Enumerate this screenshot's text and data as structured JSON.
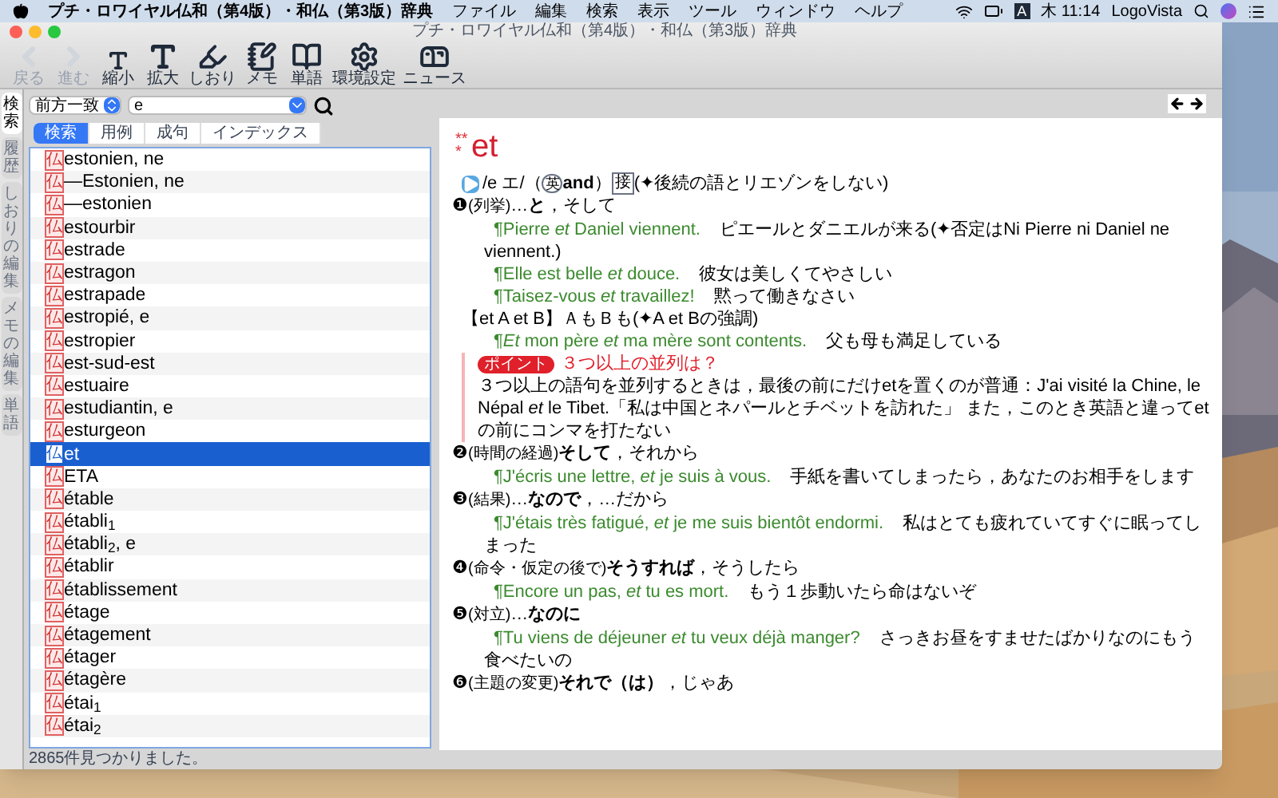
{
  "menu_bar": {
    "app_name": "プチ・ロワイヤル仏和（第4版）・和仏（第3版）辞典",
    "menus": [
      "ファイル",
      "編集",
      "検索",
      "表示",
      "ツール",
      "ウィンドウ",
      "ヘルプ"
    ],
    "input_source": "A",
    "clock": "木 11:14",
    "user": "LogoVista"
  },
  "window": {
    "title": "プチ・ロワイヤル仏和（第4版）・和仏（第3版）辞典"
  },
  "toolbar": [
    {
      "kind": "back",
      "label": "戻る",
      "disabled": true
    },
    {
      "kind": "forward",
      "label": "進む",
      "disabled": true
    },
    {
      "kind": "shrink",
      "label": "縮小",
      "disabled": false
    },
    {
      "kind": "enlarge",
      "label": "拡大",
      "disabled": false
    },
    {
      "kind": "bookmark",
      "label": "しおり",
      "disabled": false
    },
    {
      "kind": "memo",
      "label": "メモ",
      "disabled": false
    },
    {
      "kind": "words",
      "label": "単語",
      "disabled": false
    },
    {
      "kind": "settings",
      "label": "環境設定",
      "disabled": false
    },
    {
      "kind": "news",
      "label": "ニュース",
      "disabled": false
    }
  ],
  "side_tabs": [
    {
      "label": "検索",
      "selected": true
    },
    {
      "label": "履歴",
      "selected": false
    },
    {
      "label": "しおりの編集",
      "selected": false
    },
    {
      "label": "メモの編集",
      "selected": false
    },
    {
      "label": "単語",
      "selected": false
    }
  ],
  "search": {
    "mode": "前方一致",
    "query": "e"
  },
  "search_tabs": [
    {
      "label": "検索",
      "selected": true
    },
    {
      "label": "用例",
      "selected": false
    },
    {
      "label": "成句",
      "selected": false
    },
    {
      "label": "インデックス",
      "selected": false
    }
  ],
  "results": [
    {
      "dict": "仏",
      "word": "estonien, ne",
      "selected": false
    },
    {
      "dict": "仏",
      "word": "—Estonien, ne",
      "selected": false
    },
    {
      "dict": "仏",
      "word": "—estonien",
      "selected": false
    },
    {
      "dict": "仏",
      "word": "estourbir",
      "selected": false
    },
    {
      "dict": "仏",
      "word": "estrade",
      "selected": false
    },
    {
      "dict": "仏",
      "word": "estragon",
      "selected": false
    },
    {
      "dict": "仏",
      "word": "estrapade",
      "selected": false
    },
    {
      "dict": "仏",
      "word": "estropié, e",
      "selected": false
    },
    {
      "dict": "仏",
      "word": "estropier",
      "selected": false
    },
    {
      "dict": "仏",
      "word": "est-sud-est",
      "selected": false
    },
    {
      "dict": "仏",
      "word": "estuaire",
      "selected": false
    },
    {
      "dict": "仏",
      "word": "estudiantin, e",
      "selected": false
    },
    {
      "dict": "仏",
      "word": "esturgeon",
      "selected": false
    },
    {
      "dict": "仏",
      "word": "et",
      "selected": true
    },
    {
      "dict": "仏",
      "word": "ETA",
      "selected": false
    },
    {
      "dict": "仏",
      "word": "étable",
      "selected": false
    },
    {
      "dict": "仏",
      "word": "établi$_{1}$",
      "selected": false
    },
    {
      "dict": "仏",
      "word": "établi$_{2}$, e",
      "selected": false
    },
    {
      "dict": "仏",
      "word": "établir",
      "selected": false
    },
    {
      "dict": "仏",
      "word": "établissement",
      "selected": false
    },
    {
      "dict": "仏",
      "word": "étage",
      "selected": false
    },
    {
      "dict": "仏",
      "word": "étagement",
      "selected": false
    },
    {
      "dict": "仏",
      "word": "étager",
      "selected": false
    },
    {
      "dict": "仏",
      "word": "étagère",
      "selected": false
    },
    {
      "dict": "仏",
      "word": "étai$_{1}$",
      "selected": false
    },
    {
      "dict": "仏",
      "word": "étai$_{2}$",
      "selected": false
    }
  ],
  "status": "2865件見つかりました。",
  "entry": {
    "stars": "***",
    "headword": "et",
    "pron": {
      "before": "/e エ/（",
      "lang": "英",
      "word": "and",
      "after": "）",
      "pos": "接",
      "note": "(✦後続の語とリエゾンをしない)"
    },
    "blocks": [
      {
        "kind": "sense",
        "num": "❶",
        "label": "(列挙)",
        "text": "…**と**，そして"
      },
      {
        "kind": "example",
        "fr": "¶Pierre *et* Daniel viennent.",
        "ja": "ピエールとダニエルが来る(✦否定はNi Pierre ni Daniel ne viennent.)"
      },
      {
        "kind": "example",
        "fr": "¶Elle est belle *et* douce.",
        "ja": "彼女は美しくてやさしい"
      },
      {
        "kind": "example",
        "fr": "¶Taisez-vous *et* travaillez!",
        "ja": "黙って働きなさい"
      },
      {
        "kind": "phrase",
        "text": "【et A et B】ＡもＢも(✦A et Bの強調)"
      },
      {
        "kind": "example",
        "fr": "¶*Et* mon père *et* ma mère sont contents.",
        "ja": "父も母も満足している"
      },
      {
        "kind": "point",
        "badge": "ポイント",
        "title": "３つ以上の並列は？",
        "text": "３つ以上の語句を並列するときは，最後の前にだけetを置くのが普通：J'ai visité la Chine, le Népal *et* le Tibet.「私は中国とネパールとチベットを訪れた」 また，このとき英語と違ってetの前にコンマを打たない"
      },
      {
        "kind": "sense",
        "num": "❷",
        "label": "(時間の経過)",
        "text": "**そして**，それから"
      },
      {
        "kind": "example",
        "fr": "¶J'écris une lettre, *et* je suis à vous.",
        "ja": "手紙を書いてしまったら，あなたのお相手をします"
      },
      {
        "kind": "sense",
        "num": "❸",
        "label": "(結果)",
        "text": "…**なので**，…だから"
      },
      {
        "kind": "example",
        "fr": "¶J'étais très fatigué, *et* je me suis bientôt endormi.",
        "ja": "私はとても疲れていてすぐに眠ってしまった"
      },
      {
        "kind": "sense",
        "num": "❹",
        "label": "(命令・仮定の後で)",
        "text": "**そうすれば**，そうしたら"
      },
      {
        "kind": "example",
        "fr": "¶Encore un pas, *et* tu es mort.",
        "ja": "もう１歩動いたら命はないぞ"
      },
      {
        "kind": "sense",
        "num": "❺",
        "label": "(対立)",
        "text": "…**なのに**"
      },
      {
        "kind": "example",
        "fr": "¶Tu viens de déjeuner *et* tu veux déjà manger?",
        "ja": "さっきお昼をすませたばかりなのにもう食べたいの"
      },
      {
        "kind": "sense",
        "num": "❻",
        "label": "(主題の変更)",
        "text": "**それで（は）**，じゃあ"
      }
    ]
  }
}
